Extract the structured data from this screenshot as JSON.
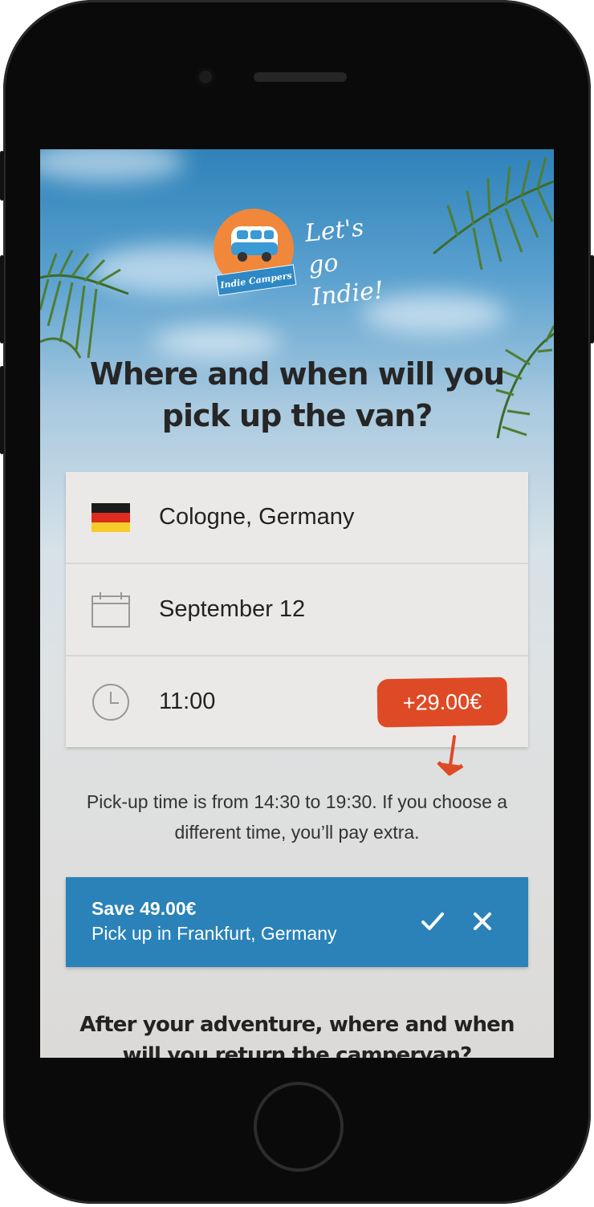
{
  "brand": {
    "name": "Indie Campers",
    "tagline_line1": "Let's go",
    "tagline_line2": "Indie!"
  },
  "pickup": {
    "heading": "Where and when will you pick up the van?",
    "location": {
      "value": "Cologne, Germany",
      "icon": "germany-flag-icon"
    },
    "date": {
      "value": "September 12",
      "icon": "calendar-icon"
    },
    "time": {
      "value": "11:00",
      "icon": "clock-icon",
      "surcharge": "+29.00€"
    },
    "note": "Pick-up time is from 14:30 to 19:30. If you choose a different time, you’ll pay extra."
  },
  "offer": {
    "title": "Save 49.00€",
    "subtitle": "Pick up in Frankfurt, Germany",
    "accept_icon": "checkmark-icon",
    "dismiss_icon": "close-icon"
  },
  "return": {
    "heading": "After your adventure, where and when will you return the campervan?"
  },
  "colors": {
    "accent_red": "#de4a26",
    "offer_blue": "#2a82b8",
    "brand_orange": "#f1873a",
    "text_dark": "#222222"
  }
}
